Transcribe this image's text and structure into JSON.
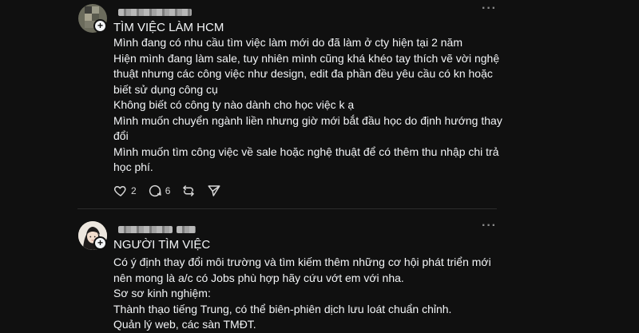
{
  "post1": {
    "title": "TÌM VIỆC LÀM HCM",
    "lines": [
      "Mình đang có nhu cầu tìm việc làm mới do đã làm ở cty hiện tại 2 năm",
      "Hiện mình đang làm sale, tuy nhiên mình cũng khá khéo tay thích vẽ vời nghệ",
      "thuật nhưng các công việc như design, edit đa phần đều yêu cầu có kn hoặc",
      "biết sử dụng công cụ",
      "Không biết có công ty nào dành cho học việc k ạ",
      "Mình muốn chuyển ngành liền nhưng giờ mới bắt đầu học do định hướng thay",
      "đổi",
      "Mình muốn tìm công việc về sale hoặc nghệ thuật để có thêm thu nhập chi trả",
      "học phí."
    ],
    "likes": "2",
    "replies": "6"
  },
  "post2": {
    "title": "NGƯỜI TÌM VIỆC",
    "lines": [
      "Có ý định thay đổi môi trường và tìm kiếm thêm những cơ hội phát triển mới",
      "nên mong là a/c có Jobs phù hợp hãy cứu vớt em với nha.",
      "Sơ sơ kinh nghiệm:",
      "Thành thạo tiếng Trung, có thể biên-phiên dịch lưu loát chuẩn chỉnh.",
      "Quản lý web, các sàn TMĐT."
    ]
  },
  "icons": {
    "follow": "plus-icon",
    "more": "more-icon",
    "like": "heart-icon",
    "reply": "comment-icon",
    "repost": "repost-icon",
    "share": "send-icon"
  },
  "ui": {
    "follow_symbol": "+",
    "more_symbol": "···"
  },
  "colors": {
    "background": "#101010",
    "text": "#f3f5f7",
    "muted": "#8a8a8a"
  }
}
